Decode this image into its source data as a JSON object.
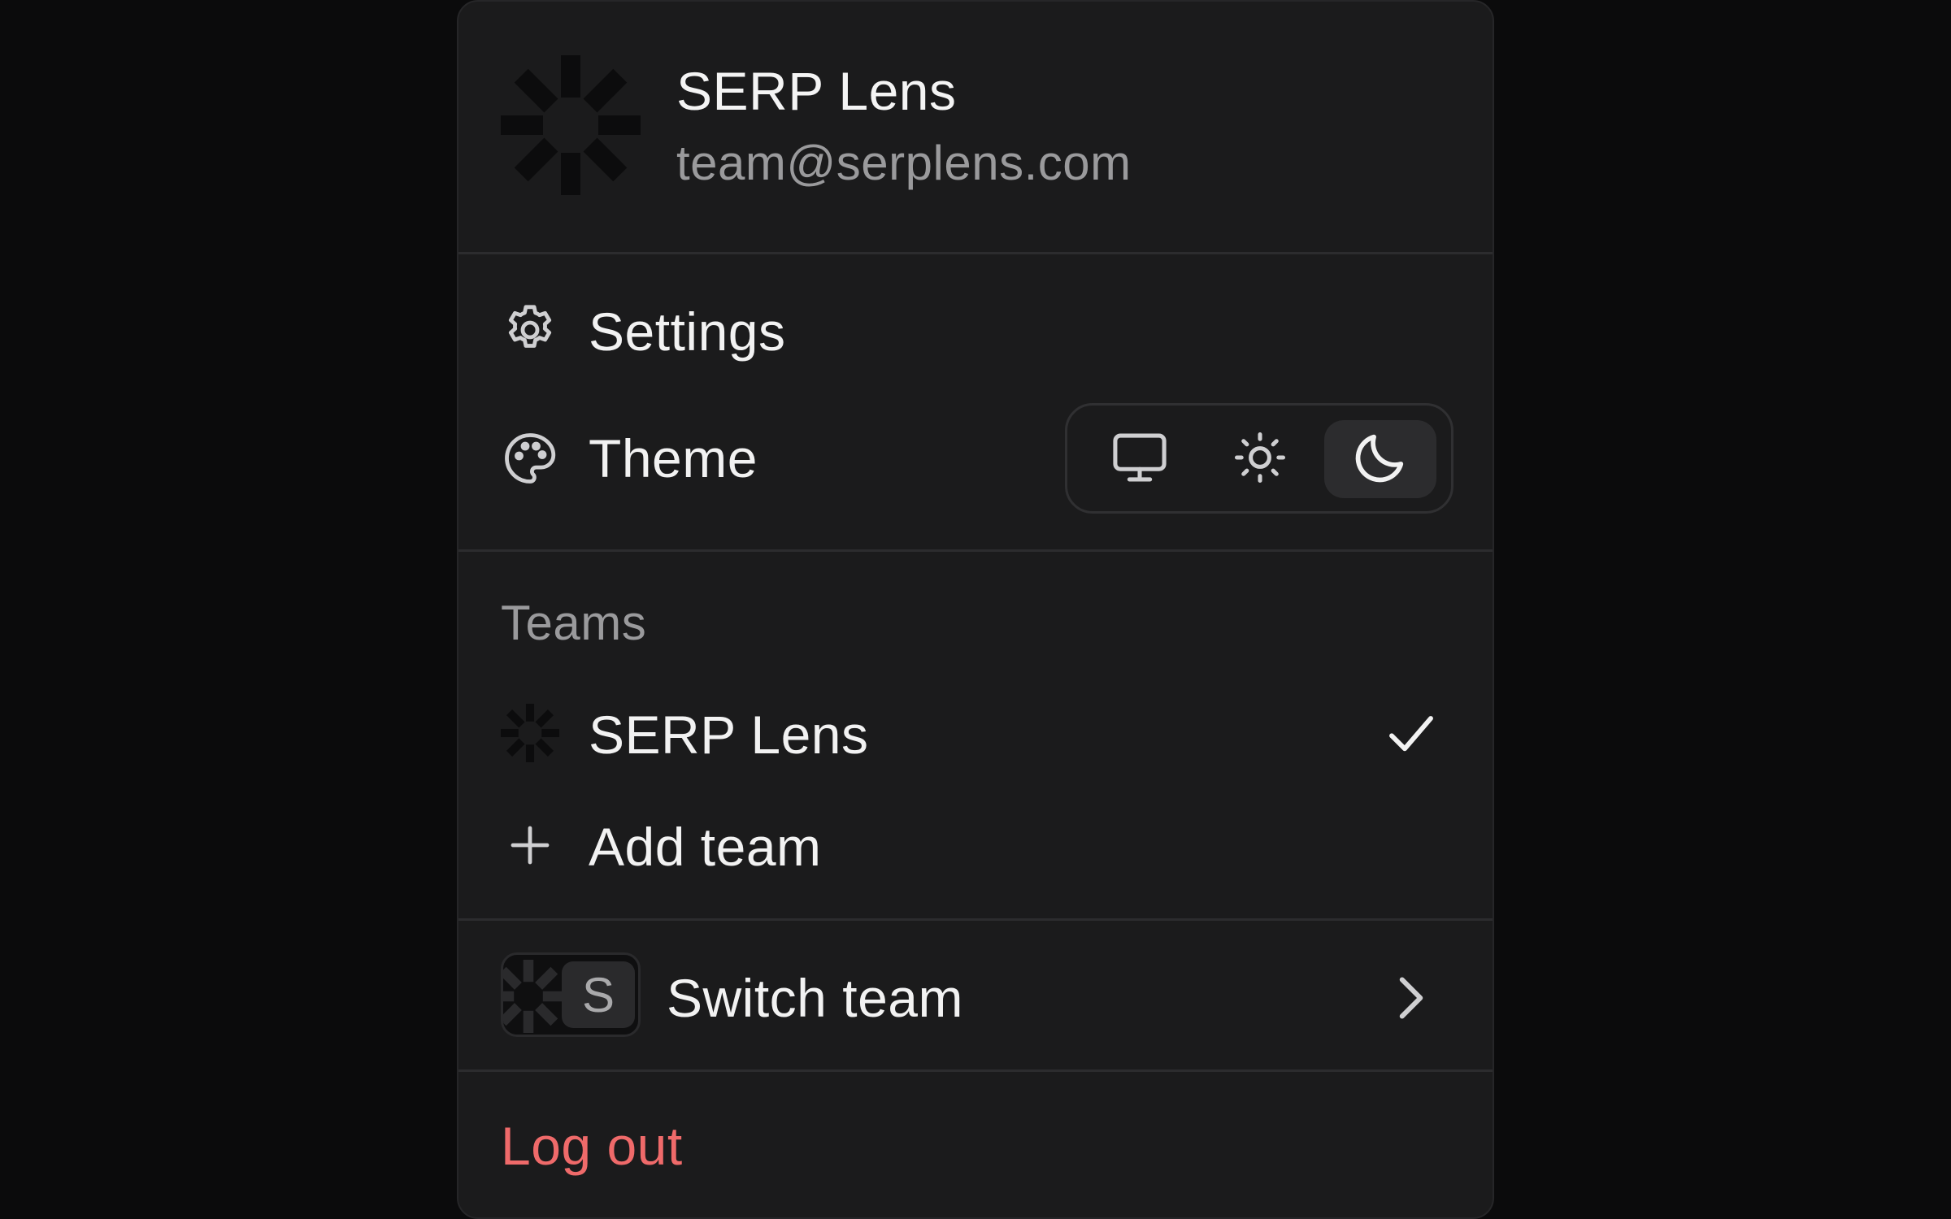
{
  "header": {
    "team_name": "SERP Lens",
    "email": "team@serplens.com",
    "logo_icon": "serp-lens-logo-icon"
  },
  "menu": {
    "settings_label": "Settings",
    "theme_label": "Theme",
    "theme_options": [
      {
        "name": "system",
        "icon": "monitor-icon"
      },
      {
        "name": "light",
        "icon": "sun-icon"
      },
      {
        "name": "dark",
        "icon": "moon-icon"
      }
    ],
    "theme_selected": "dark"
  },
  "teams": {
    "heading": "Teams",
    "items": [
      {
        "name": "SERP Lens",
        "selected": true
      }
    ],
    "add_team_label": "Add team"
  },
  "switch_team": {
    "label": "Switch team",
    "avatar_letter": "S"
  },
  "logout": {
    "label": "Log out",
    "color": "#ef6a6a"
  },
  "colors": {
    "background": "#0b0b0c",
    "menu_background": "#1b1b1c",
    "text_primary": "#f2f2f2",
    "text_secondary": "#9a9a9c"
  }
}
